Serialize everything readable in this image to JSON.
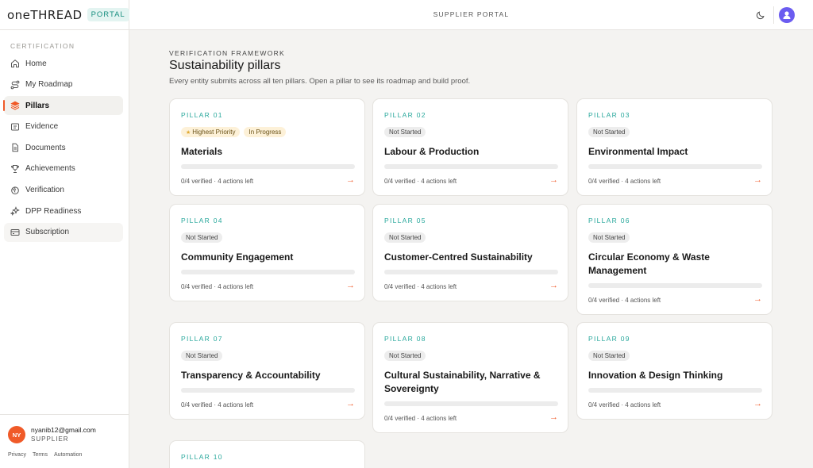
{
  "brand": {
    "logo": "oneTHREAD",
    "badge": "PORTAL"
  },
  "sidebar": {
    "section": "CERTIFICATION",
    "items": [
      {
        "label": "Home",
        "icon": "home-icon"
      },
      {
        "label": "My Roadmap",
        "icon": "route-icon"
      },
      {
        "label": "Pillars",
        "icon": "layers-icon",
        "active": true
      },
      {
        "label": "Evidence",
        "icon": "evidence-icon"
      },
      {
        "label": "Documents",
        "icon": "document-icon"
      },
      {
        "label": "Achievements",
        "icon": "trophy-icon"
      },
      {
        "label": "Verification",
        "icon": "verification-icon"
      },
      {
        "label": "DPP Readiness",
        "icon": "sparkle-icon"
      },
      {
        "label": "Subscription",
        "icon": "card-icon"
      }
    ],
    "user": {
      "initials": "NY",
      "email": "nyanib12@gmail.com",
      "role": "SUPPLIER"
    },
    "footer": [
      "Privacy",
      "Terms",
      "Automation"
    ]
  },
  "header": {
    "title": "SUPPLIER PORTAL"
  },
  "main": {
    "eyebrow": "VERIFICATION FRAMEWORK",
    "title": "Sustainability pillars",
    "subtitle": "Every entity submits across all ten pillars. Open a pillar to see its roadmap and build proof.",
    "pillars": [
      {
        "num": "PILLAR 01",
        "tags": [
          "Highest Priority",
          "In Progress"
        ],
        "title": "Materials",
        "meta": "0/4 verified · 4 actions left",
        "progress": 0
      },
      {
        "num": "PILLAR 02",
        "tags": [
          "Not Started"
        ],
        "title": "Labour & Production",
        "meta": "0/4 verified · 4 actions left",
        "progress": 0
      },
      {
        "num": "PILLAR 03",
        "tags": [
          "Not Started"
        ],
        "title": "Environmental Impact",
        "meta": "0/4 verified · 4 actions left",
        "progress": 0
      },
      {
        "num": "PILLAR 04",
        "tags": [
          "Not Started"
        ],
        "title": "Community Engagement",
        "meta": "0/4 verified · 4 actions left",
        "progress": 0
      },
      {
        "num": "PILLAR 05",
        "tags": [
          "Not Started"
        ],
        "title": "Customer-Centred Sustainability",
        "meta": "0/4 verified · 4 actions left",
        "progress": 0
      },
      {
        "num": "PILLAR 06",
        "tags": [
          "Not Started"
        ],
        "title": "Circular Economy & Waste Management",
        "meta": "0/4 verified · 4 actions left",
        "progress": 0
      },
      {
        "num": "PILLAR 07",
        "tags": [
          "Not Started"
        ],
        "title": "Transparency & Accountability",
        "meta": "0/4 verified · 4 actions left",
        "progress": 0
      },
      {
        "num": "PILLAR 08",
        "tags": [
          "Not Started"
        ],
        "title": "Cultural Sustainability, Narrative & Sovereignty",
        "meta": "0/4 verified · 4 actions left",
        "progress": 0
      },
      {
        "num": "PILLAR 09",
        "tags": [
          "Not Started"
        ],
        "title": "Innovation & Design Thinking",
        "meta": "0/4 verified · 4 actions left",
        "progress": 0
      },
      {
        "num": "PILLAR 10"
      }
    ]
  },
  "colors": {
    "accent": "#f05a28",
    "teal": "#27a79b"
  }
}
